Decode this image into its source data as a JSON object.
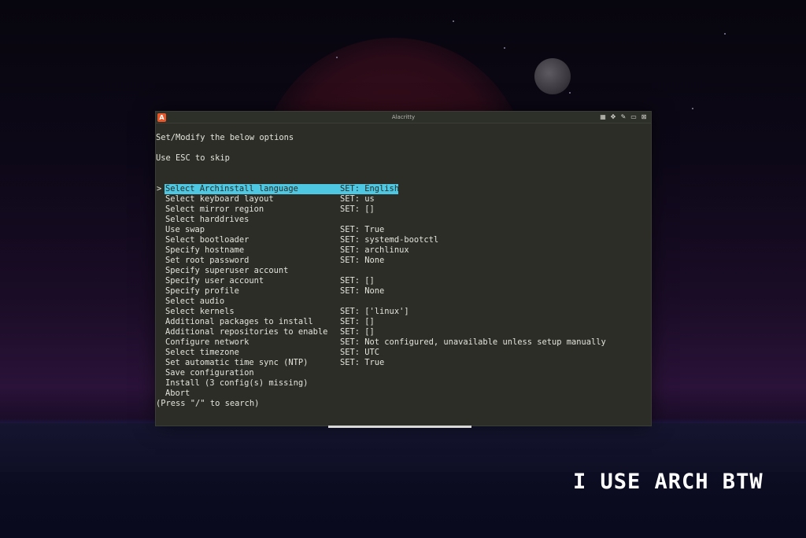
{
  "window": {
    "title": "Alacritty",
    "app_icon": "A",
    "controls": [
      "tile-icon",
      "move-icon",
      "pin-icon",
      "maximize-icon",
      "close-icon"
    ]
  },
  "terminal": {
    "header_line_1": "Set/Modify the below options",
    "header_line_2": "Use ESC to skip",
    "cursor_glyph": ">",
    "menu_items": [
      {
        "label": "Select Archinstall language",
        "value": "SET: English",
        "selected": true
      },
      {
        "label": "Select keyboard layout",
        "value": "SET: us"
      },
      {
        "label": "Select mirror region",
        "value": "SET: []"
      },
      {
        "label": "Select harddrives",
        "value": ""
      },
      {
        "label": "Use swap",
        "value": "SET: True"
      },
      {
        "label": "Select bootloader",
        "value": "SET: systemd-bootctl"
      },
      {
        "label": "Specify hostname",
        "value": "SET: archlinux"
      },
      {
        "label": "Set root password",
        "value": "SET: None"
      },
      {
        "label": "Specify superuser account",
        "value": ""
      },
      {
        "label": "Specify user account",
        "value": "SET: []"
      },
      {
        "label": "Specify profile",
        "value": "SET: None"
      },
      {
        "label": "Select audio",
        "value": ""
      },
      {
        "label": "Select kernels",
        "value": "SET: ['linux']"
      },
      {
        "label": "Additional packages to install",
        "value": "SET: []"
      },
      {
        "label": "Additional repositories to enable",
        "value": "SET: []"
      },
      {
        "label": "Configure network",
        "value": "SET: Not configured, unavailable unless setup manually"
      },
      {
        "label": "Select timezone",
        "value": "SET: UTC"
      },
      {
        "label": "Set automatic time sync (NTP)",
        "value": "SET: True"
      },
      {
        "label": "Save configuration",
        "value": ""
      },
      {
        "label": "Install (3 config(s) missing)",
        "value": ""
      },
      {
        "label": "Abort",
        "value": ""
      }
    ],
    "footer": "(Press \"/\" to search)"
  },
  "wallpaper": {
    "tagline": "I USE ARCH BTW"
  },
  "colors": {
    "highlight": "#4ec7e3",
    "terminal_bg": "#2b2d26",
    "terminal_fg": "#e4e4dc"
  }
}
